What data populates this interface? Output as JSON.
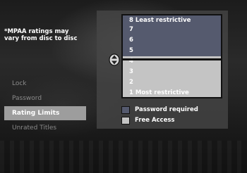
{
  "note": "*MPAA ratings may\nvary from disc to disc",
  "menu": {
    "items": [
      {
        "label": "Lock"
      },
      {
        "label": "Password"
      },
      {
        "label": "Rating Limits"
      },
      {
        "label": "Unrated Titles"
      }
    ],
    "selected_index": 2
  },
  "ratings": {
    "items": [
      {
        "label": "8  Least restrictive",
        "level": 8
      },
      {
        "label": "7",
        "level": 7
      },
      {
        "label": "6",
        "level": 6
      },
      {
        "label": "5",
        "level": 5
      },
      {
        "label": "4",
        "level": 4
      },
      {
        "label": "3",
        "level": 3
      },
      {
        "label": "2",
        "level": 2
      },
      {
        "label": "1  Most restrictive",
        "level": 1
      }
    ],
    "current_limit": 5
  },
  "legend": {
    "password_required": "Password required",
    "free_access": "Free Access"
  },
  "colors": {
    "restricted": "#555a6e",
    "free": "#c4c4c4",
    "selected_menu": "#9d9d9d"
  },
  "icons": {
    "slider": "up-down-slider-icon"
  }
}
